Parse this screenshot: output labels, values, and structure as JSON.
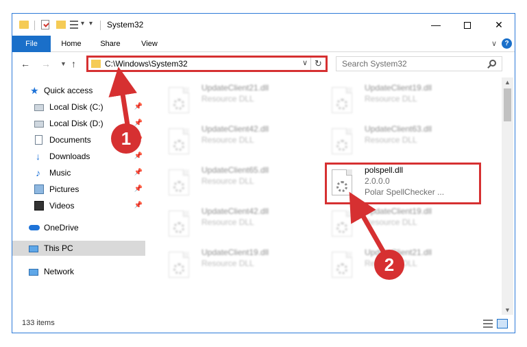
{
  "window": {
    "title": "System32",
    "minimize": "—",
    "close": "✕"
  },
  "ribbon": {
    "tabs": [
      "File",
      "Home",
      "Share",
      "View"
    ],
    "expand": "∨",
    "help": "?"
  },
  "nav_buttons": {
    "back": "←",
    "forward": "→",
    "recent": "▼",
    "up": "↑"
  },
  "address": {
    "path": "C:\\Windows\\System32",
    "dropdown": "∨",
    "refresh": "↻"
  },
  "search": {
    "placeholder": "Search System32"
  },
  "sidebar": {
    "items": [
      {
        "label": "Quick access",
        "icon": "star-icon",
        "pinned": false
      },
      {
        "label": "Local Disk (C:)",
        "icon": "disk-icon",
        "pinned": true
      },
      {
        "label": "Local Disk (D:)",
        "icon": "disk-icon",
        "pinned": true
      },
      {
        "label": "Documents",
        "icon": "documents-icon",
        "pinned": true
      },
      {
        "label": "Downloads",
        "icon": "download-icon",
        "pinned": true
      },
      {
        "label": "Music",
        "icon": "music-icon",
        "pinned": true
      },
      {
        "label": "Pictures",
        "icon": "pictures-icon",
        "pinned": true
      },
      {
        "label": "Videos",
        "icon": "videos-icon",
        "pinned": true
      },
      {
        "label": "OneDrive",
        "icon": "onedrive-icon",
        "pinned": false
      },
      {
        "label": "This PC",
        "icon": "this-pc-icon",
        "pinned": false,
        "selected": true
      },
      {
        "label": "Network",
        "icon": "network-icon",
        "pinned": false
      }
    ],
    "pin_glyph": "📌"
  },
  "files": [
    {
      "name": "UpdateClient21.dll",
      "line2": "Resource DLL",
      "line3": "",
      "blurred": true
    },
    {
      "name": "UpdateClient19.dll",
      "line2": "Resource DLL",
      "line3": "",
      "blurred": true
    },
    {
      "name": "UpdateClient42.dll",
      "line2": "Resource DLL",
      "line3": "",
      "blurred": true
    },
    {
      "name": "UpdateClient63.dll",
      "line2": "Resource DLL",
      "line3": "",
      "blurred": true
    },
    {
      "name": "UpdateClient65.dll",
      "line2": "Resource DLL",
      "line3": "",
      "blurred": true
    },
    {
      "name": "polspell.dll",
      "line2": "2.0.0.0",
      "line3": "Polar SpellChecker ...",
      "blurred": false,
      "highlighted": true
    },
    {
      "name": "UpdateClient42.dll",
      "line2": "Resource DLL",
      "line3": "",
      "blurred": true
    },
    {
      "name": "UpdateClient19.dll",
      "line2": "Resource DLL",
      "line3": "",
      "blurred": true
    },
    {
      "name": "UpdateClient19.dll",
      "line2": "Resource DLL",
      "line3": "",
      "blurred": true
    },
    {
      "name": "UpdateClient21.dll",
      "line2": "Resource DLL",
      "line3": "",
      "blurred": true
    }
  ],
  "status": {
    "item_count": "133 items"
  },
  "annotations": {
    "step1": "1",
    "step2": "2",
    "color": "#d63031"
  },
  "colors": {
    "accent": "#1a6fc9",
    "folder": "#f5cb55",
    "annotation": "#d63031"
  }
}
